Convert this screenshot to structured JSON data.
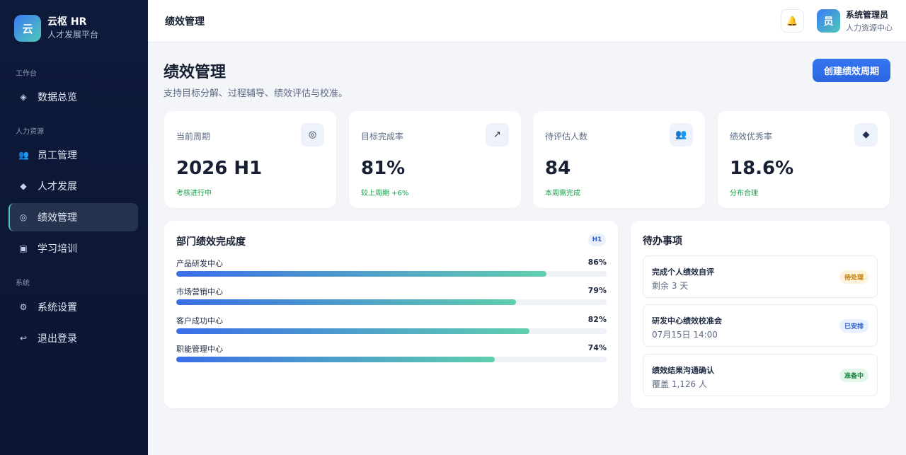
{
  "brand": {
    "logo": "云",
    "name": "云枢 HR",
    "subtitle": "人才发展平台"
  },
  "sidebar": {
    "sections": [
      "工作台",
      "人力资源",
      "系统"
    ],
    "items": [
      {
        "label": "数据总览",
        "icon": "diamond-outline-icon",
        "glyph": "◈"
      },
      {
        "label": "员工管理",
        "icon": "users-icon",
        "glyph": "👥"
      },
      {
        "label": "人才发展",
        "icon": "diamond-icon",
        "glyph": "◆"
      },
      {
        "label": "绩效管理",
        "icon": "target-icon",
        "glyph": "◎"
      },
      {
        "label": "学习培训",
        "icon": "square-icon",
        "glyph": "▣"
      },
      {
        "label": "系统设置",
        "icon": "gear-icon",
        "glyph": "⚙"
      },
      {
        "label": "退出登录",
        "icon": "logout-icon",
        "glyph": "↩"
      }
    ],
    "active": "绩效管理"
  },
  "topbar": {
    "title": "绩效管理",
    "bell_glyph": "🔔",
    "user": {
      "avatar": "员",
      "name": "系统管理员",
      "role": "人力资源中心"
    }
  },
  "page": {
    "title": "绩效管理",
    "subtitle": "支持目标分解、过程辅导、绩效评估与校准。",
    "create_label": "创建绩效周期"
  },
  "stats": [
    {
      "label": "当前周期",
      "value": "2026 H1",
      "note": "考核进行中",
      "icon": "target-icon",
      "glyph": "◎"
    },
    {
      "label": "目标完成率",
      "value": "81%",
      "note": "较上周期 +6%",
      "icon": "trend-up-icon",
      "glyph": "↗"
    },
    {
      "label": "待评估人数",
      "value": "84",
      "note": "本周需完成",
      "icon": "users-icon",
      "glyph": "👥"
    },
    {
      "label": "绩效优秀率",
      "value": "18.6%",
      "note": "分布合理",
      "icon": "diamond-icon",
      "glyph": "◆"
    }
  ],
  "departments": {
    "title": "部门绩效完成度",
    "badge": "H1",
    "rows": [
      {
        "name": "产品研发中心",
        "percent": 86,
        "label": "86%"
      },
      {
        "name": "市场营销中心",
        "percent": 79,
        "label": "79%"
      },
      {
        "name": "客户成功中心",
        "percent": 82,
        "label": "82%"
      },
      {
        "name": "职能管理中心",
        "percent": 74,
        "label": "74%"
      }
    ]
  },
  "todo": {
    "title": "待办事项",
    "items": [
      {
        "name": "完成个人绩效自评",
        "meta": "剩余 3 天",
        "tag": "待处理",
        "status": "warn"
      },
      {
        "name": "研发中心绩效校准会",
        "meta": "07月15日 14:00",
        "tag": "已安排",
        "status": "info"
      },
      {
        "name": "绩效结果沟通确认",
        "meta": "覆盖 1,126 人",
        "tag": "准备中",
        "status": "ok"
      }
    ]
  },
  "colors": {
    "accent": "#2f6fe8",
    "sidebar": "#0e1a3a",
    "success": "#16a34a",
    "teal": "#4fc8b6"
  }
}
